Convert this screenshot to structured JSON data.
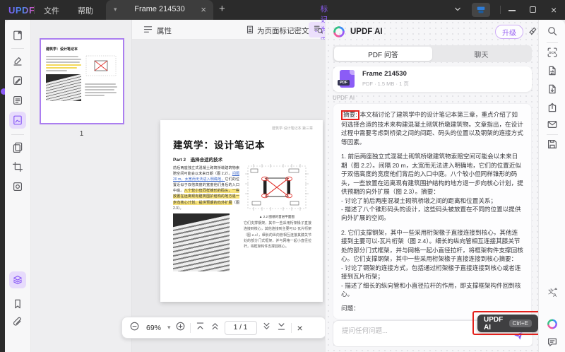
{
  "icons": {
    "caret_down": "▾",
    "close_x": "×",
    "plus": "+",
    "ocr_text": "OCR",
    "translate_cn": "文",
    "translate_a": "A",
    "redact_letter": "T"
  },
  "colors": {
    "accent_purple": "#8B5CF6",
    "accent_light": "#ECE0FC",
    "annotation_red": "#E3201B",
    "highlight_yellow": "#F7E27A",
    "titlebar_bg": "#2B2B2B"
  },
  "titlebar": {
    "logo": "UPDF",
    "menu_file": "文件",
    "menu_help": "帮助",
    "tab_title": "Frame 214530"
  },
  "doc_toolbar": {
    "properties_label": "属性",
    "redact_selection_label": "标记为密文",
    "redact_page_label": "为页面标记密文"
  },
  "thumbnail_panel": {
    "page_number": "1"
  },
  "document": {
    "running_header": "建筑学·设计笔记本 第三章",
    "title": "建筑学：设计笔记本",
    "part_heading": "Part 2　选择合适的技术",
    "body_plain1": "前后两座独立式混凝土砌筑桥墩建筑物索赔空间可能会以未来日期（图 2.2）。",
    "body_blue": "间隔 20 m，太宽而无法进入明确地，",
    "body_plain2": "它们的位置近似于双倍高度的宽度他们身后的入口中庭。",
    "body_highlight": "八个较小但同样锥形的码头，一些放置在远离现有建筑围护结构的地方退一步向核心计划，提供预期的向外扩展",
    "body_post": "（图 2.3）。",
    "figure_caption": "▲ 2.2 图纸的首层平面图",
    "right_col_text": "它们支撑钢架，其中一些采用桁架椽子直接连接到核心，其他连接到主要可以-瓦片桁架（图 2.4），细长的纵向管相互连接其膝关节处的部分门式框架，并与网格一起小直径拉杆，将框架构件支撑回核心。"
  },
  "bottom_toolbar": {
    "zoom_level": "69%",
    "page_indicator": "1 / 1"
  },
  "ai_panel": {
    "title": "UPDF AI",
    "upgrade_label": "升级",
    "tab_qa": "PDF 问答",
    "tab_chat": "聊天",
    "file_card": {
      "badge": "PDF",
      "name": "Frame 214530",
      "meta": "PDF · 1.5 MB · 1 页"
    },
    "sender_label": "UPDF AI",
    "message": {
      "summary_label": "摘要:",
      "intro": "本文档讨论了建筑学中的设计笔记本第三章，重点介绍了如何选择合适的技术来构建混凝土砌筑桥墩建筑物。文章指出，在设计过程中需要考虑到桥梁之间的间距、码头的位置以及钢架的连接方式等因素。",
      "section1": "1. 前后两座独立式混凝土砌筑桥墩建筑物索赔空间可能会以未来日期（图 2.2）。间隔 20 m，太宽而无法进入明确地，它们的位置近似于双倍高度的宽度他们背后的入口中庭。八个较小但同样锥形的码头，一些放置在远离现有建筑围护结构的地方退一步向核心计划，提供预期的向外扩展（图 2.3）。摘要：\n- 讨论了前后两座混凝土砌筑桥墩之间的距离和位置关系；\n- 描述了八个锥形码头的设计，这些码头被放置在不同的位置以提供向外扩展的空间。",
      "section2": "2. 它们支撑钢架，其中一些采用桁架椽子直接连接到核心，其他连接到主要可以-瓦片桁架（图 2.4）。细长的纵向管相互连接其膝关节处的部分门式框架，并与网格一起小直径拉杆，将框架构件支撑回核心。它们支撑钢架，其中一些采用桁架椽子直接连接到核心摘要：\n- 讨论了钢架的连接方式，包括通过桁架椽子直接连接到核心或者连接到瓦片桁架；\n- 描述了细长的纵向管和小直径拉杆的作用，即支撑框架构件回到核心。",
      "question_label": "问题："
    },
    "shortcut_tooltip": {
      "label": "UPDF AI",
      "shortcut": "Ctrl+E"
    },
    "input_placeholder": "提问任何问题..."
  }
}
